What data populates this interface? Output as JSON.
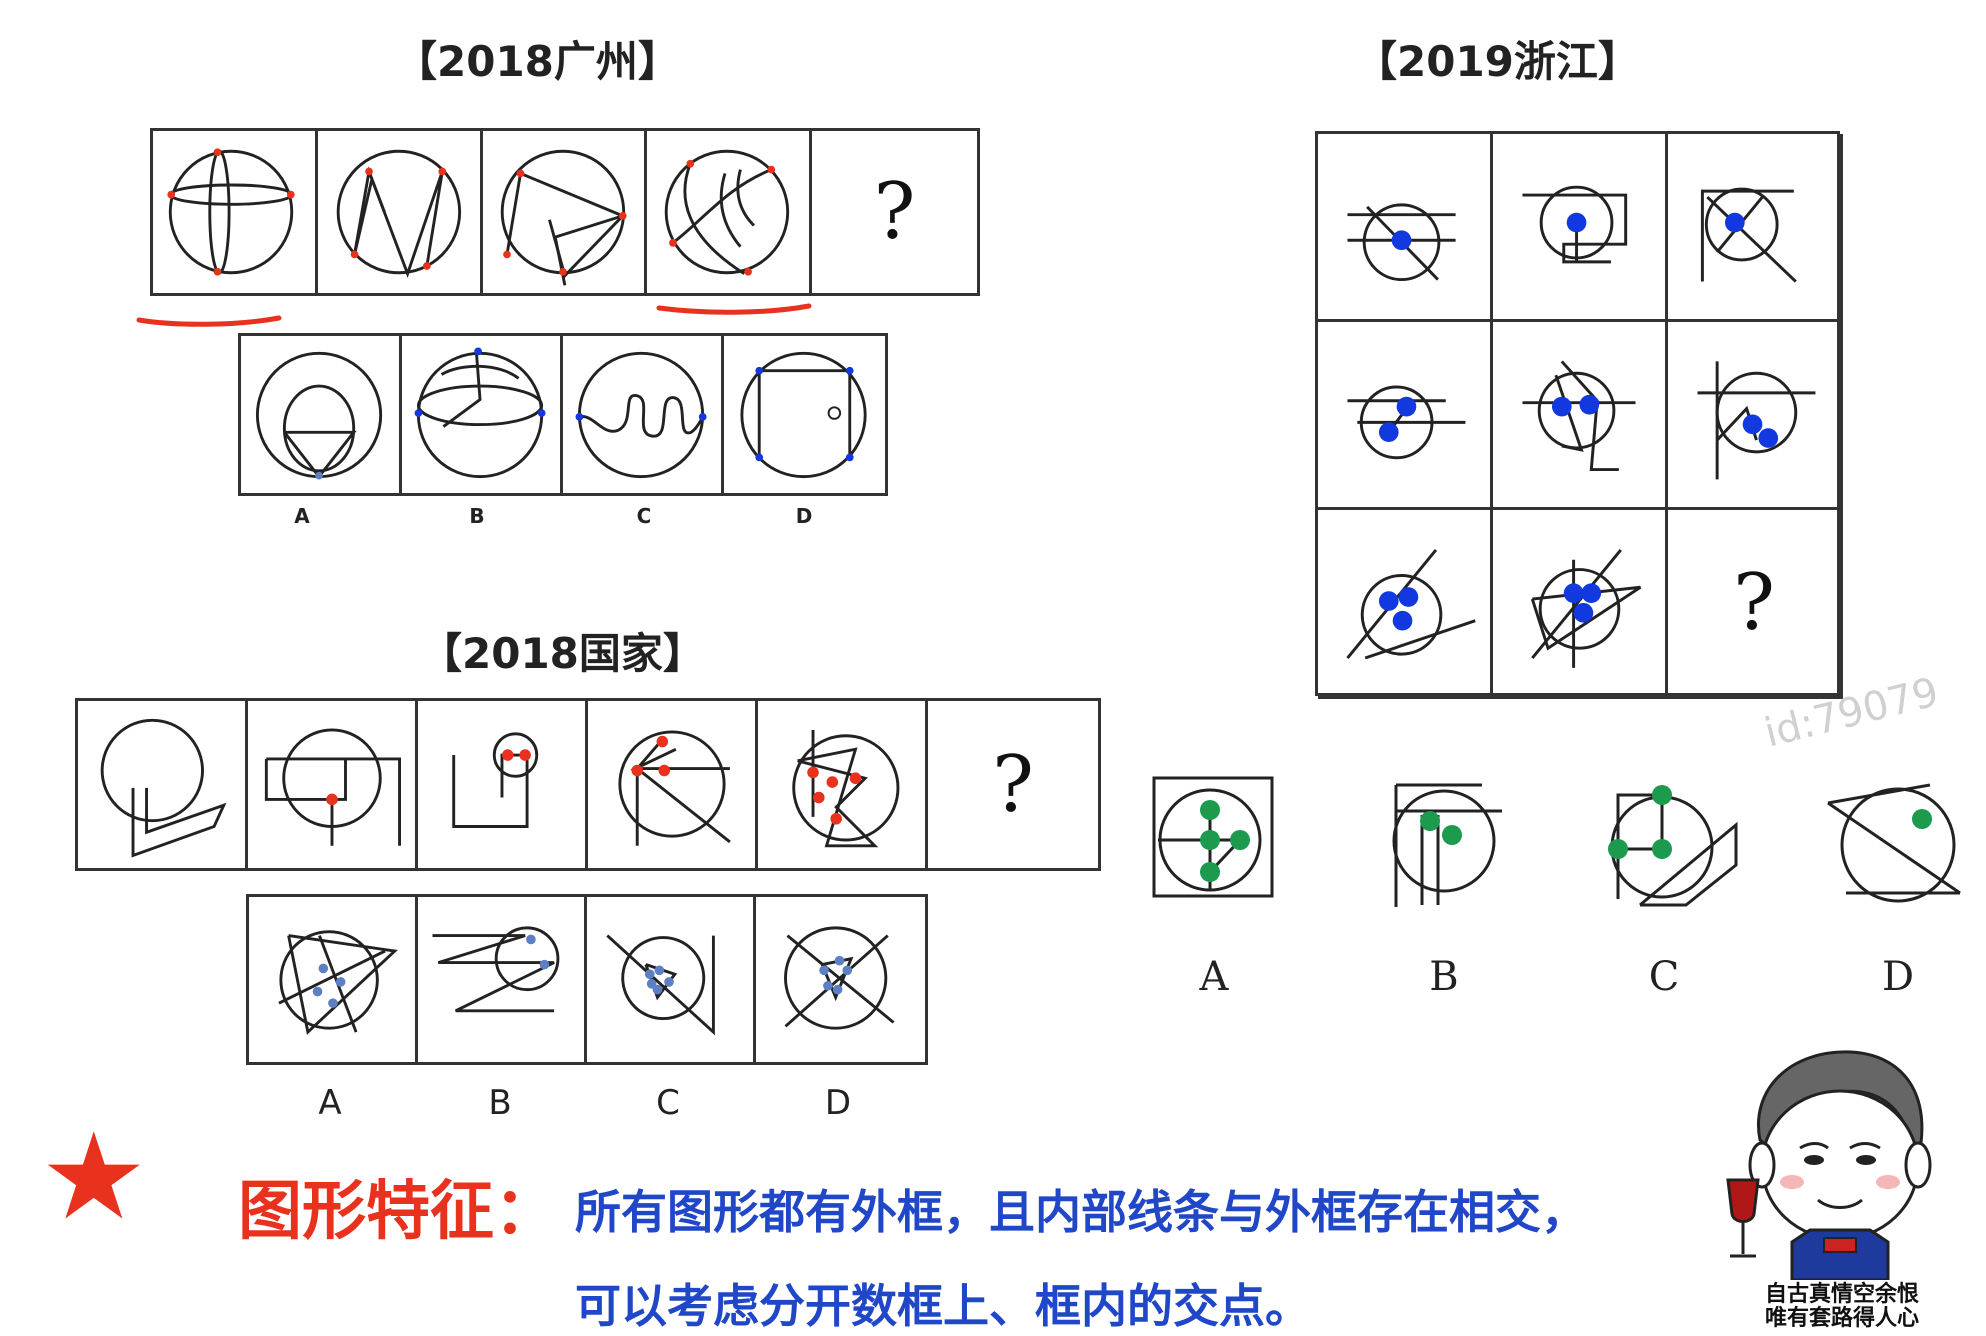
{
  "sections": {
    "guangzhou": {
      "title": "【2018广州】",
      "question_mark": "?",
      "option_labels": [
        "A",
        "B",
        "C",
        "D"
      ]
    },
    "zhejiang": {
      "title": "【2019浙江】",
      "question_mark": "?",
      "option_labels": [
        "A",
        "B",
        "C",
        "D"
      ]
    },
    "guojia": {
      "title": "【2018国家】",
      "question_mark": "?",
      "option_labels": [
        "A",
        "B",
        "C",
        "D"
      ]
    }
  },
  "watermark": "id:79079",
  "feature": {
    "icon": "star-icon",
    "title": "图形特征：",
    "line1": "所有图形都有外框，且内部线条与外框存在相交，",
    "line2": "可以考虑分开数框上、框内的交点。"
  },
  "mascot": {
    "caption_line1": "自古真情空余恨",
    "caption_line2": "唯有套路得人心"
  },
  "colors": {
    "accent_red": "#e8321e",
    "text_blue": "#1f47c7",
    "dot_red": "#e8321e",
    "dot_blue": "#1238e0",
    "dot_green": "#1c9a4e",
    "dot_gray_blue": "#5d7fc4"
  }
}
